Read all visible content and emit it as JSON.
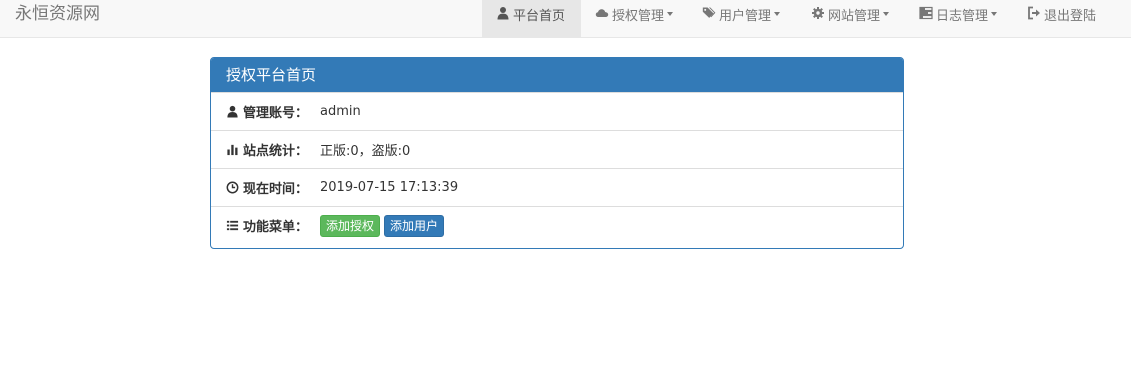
{
  "navbar": {
    "brand": "永恒资源网",
    "items": [
      {
        "label": "平台首页",
        "icon": "user-icon",
        "active": true,
        "dropdown": false
      },
      {
        "label": "授权管理",
        "icon": "cloud-icon",
        "active": false,
        "dropdown": true
      },
      {
        "label": "用户管理",
        "icon": "tags-icon",
        "active": false,
        "dropdown": true
      },
      {
        "label": "网站管理",
        "icon": "gear-icon",
        "active": false,
        "dropdown": true
      },
      {
        "label": "日志管理",
        "icon": "tasks-icon",
        "active": false,
        "dropdown": true
      },
      {
        "label": "退出登陆",
        "icon": "logout-icon",
        "active": false,
        "dropdown": false
      }
    ]
  },
  "panel": {
    "title": "授权平台首页",
    "rows": [
      {
        "icon": "user-icon",
        "label": "管理账号：",
        "value": "admin"
      },
      {
        "icon": "bar-chart-icon",
        "label": "站点统计：",
        "value": "正版:0，盗版:0"
      },
      {
        "icon": "clock-icon",
        "label": "现在时间：",
        "value": "2019-07-15 17:13:39"
      },
      {
        "icon": "list-icon",
        "label": "功能菜单：",
        "value": ""
      }
    ],
    "buttons": {
      "add_auth": "添加授权",
      "add_user": "添加用户"
    }
  },
  "colors": {
    "primary": "#337ab7",
    "success": "#5cb85c",
    "navbar_bg": "#f8f8f8",
    "nav_active_bg": "#e7e7e7"
  }
}
